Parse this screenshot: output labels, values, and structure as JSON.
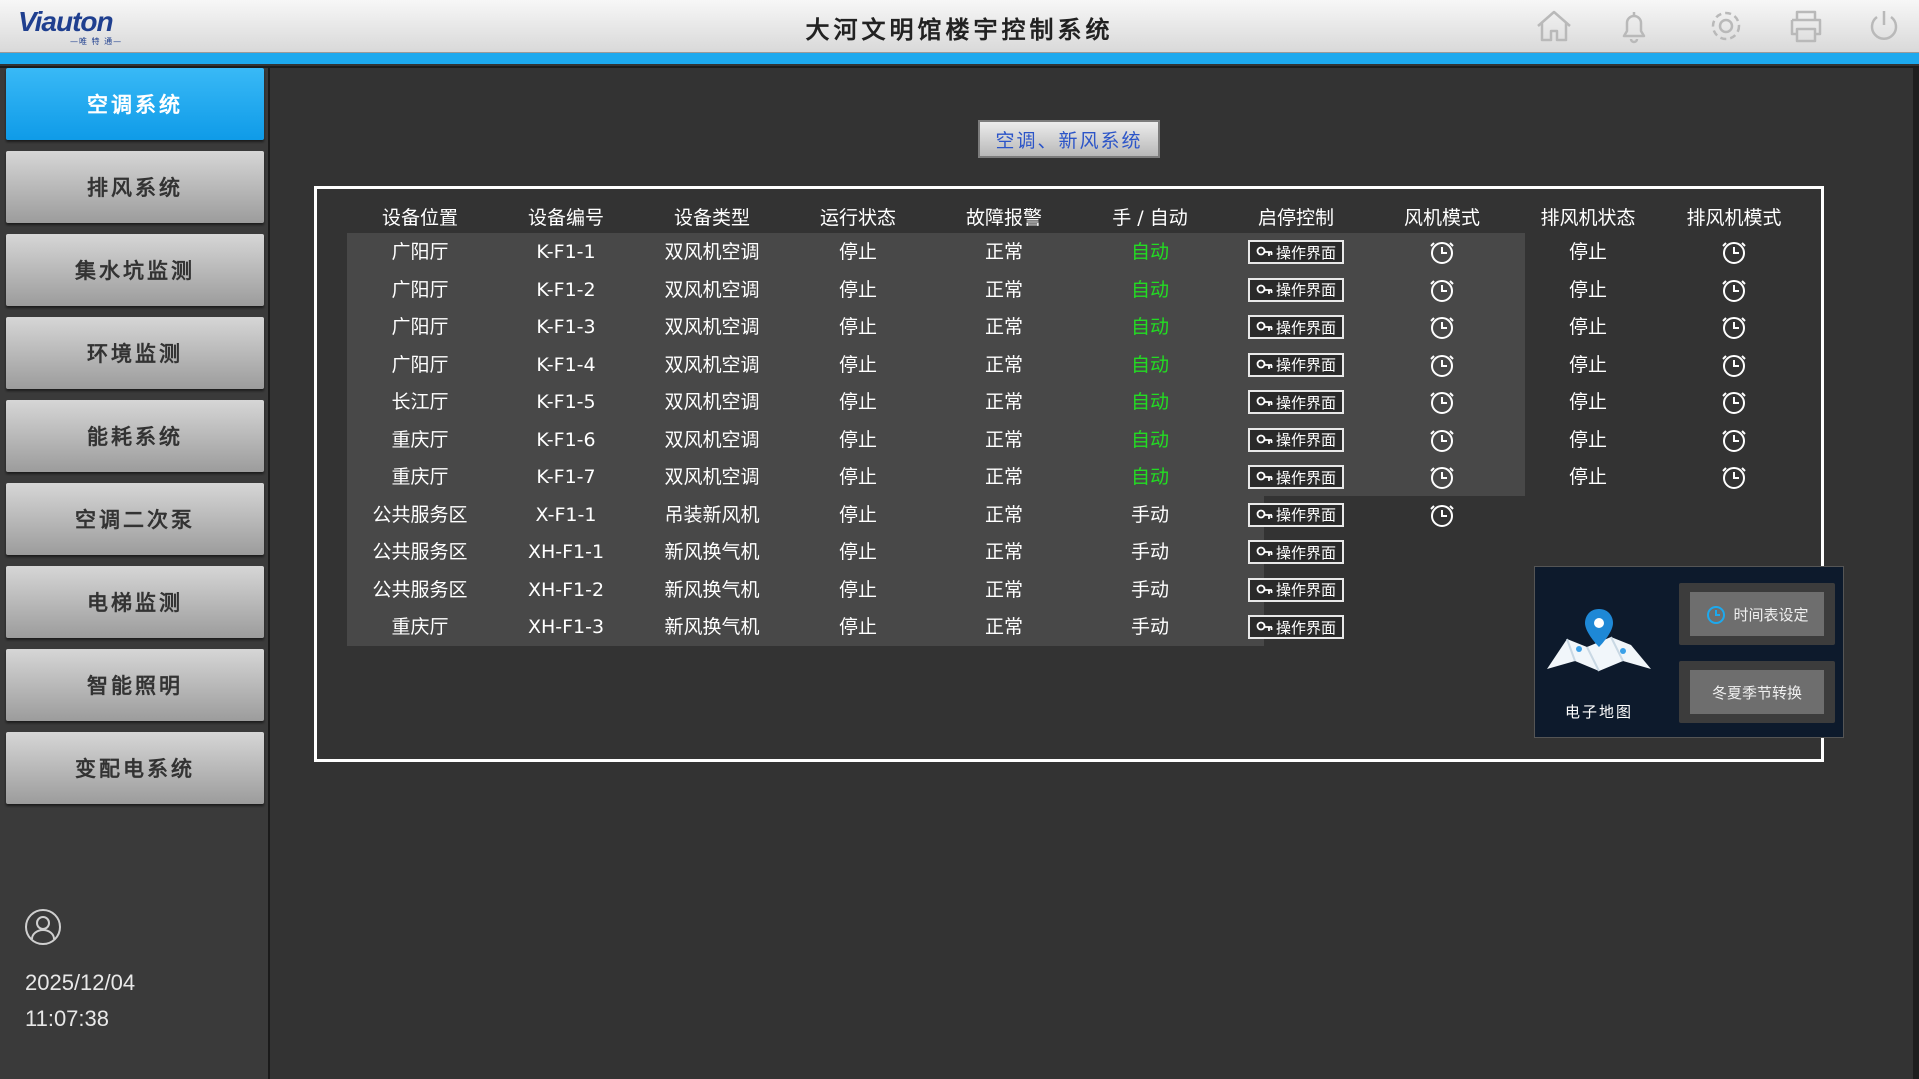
{
  "header": {
    "logo_text": "Viauton",
    "logo_tagline": "—唯 特 通—",
    "title": "大河文明馆楼宇控制系统",
    "icons": [
      "home-icon",
      "bell-icon",
      "gear-icon",
      "printer-icon",
      "power-icon"
    ]
  },
  "sidebar": {
    "items": [
      {
        "label": "空调系统",
        "active": true
      },
      {
        "label": "排风系统"
      },
      {
        "label": "集水坑监测"
      },
      {
        "label": "环境监测"
      },
      {
        "label": "能耗系统"
      },
      {
        "label": "空调二次泵"
      },
      {
        "label": "电梯监测"
      },
      {
        "label": "智能照明"
      },
      {
        "label": "变配电系统"
      }
    ],
    "date": "2025/12/04",
    "time": "11:07:38"
  },
  "main": {
    "section_title": "空调、新风系统",
    "columns": [
      "设备位置",
      "设备编号",
      "设备类型",
      "运行状态",
      "故障报警",
      "手 / 自动",
      "启停控制",
      "风机模式",
      "排风机状态",
      "排风机模式"
    ],
    "op_label": "操作界面",
    "rows": [
      {
        "location": "广阳厅",
        "id": "K-F1-1",
        "type": "双风机空调",
        "run": "停止",
        "fault": "正常",
        "mode": "自动",
        "fan_mode": "clock-icon",
        "exhaust_status": "停止",
        "exhaust_mode": "clock-icon"
      },
      {
        "location": "广阳厅",
        "id": "K-F1-2",
        "type": "双风机空调",
        "run": "停止",
        "fault": "正常",
        "mode": "自动",
        "fan_mode": "clock-icon",
        "exhaust_status": "停止",
        "exhaust_mode": "clock-icon"
      },
      {
        "location": "广阳厅",
        "id": "K-F1-3",
        "type": "双风机空调",
        "run": "停止",
        "fault": "正常",
        "mode": "自动",
        "fan_mode": "clock-icon",
        "exhaust_status": "停止",
        "exhaust_mode": "clock-icon"
      },
      {
        "location": "广阳厅",
        "id": "K-F1-4",
        "type": "双风机空调",
        "run": "停止",
        "fault": "正常",
        "mode": "自动",
        "fan_mode": "clock-icon",
        "exhaust_status": "停止",
        "exhaust_mode": "clock-icon"
      },
      {
        "location": "长江厅",
        "id": "K-F1-5",
        "type": "双风机空调",
        "run": "停止",
        "fault": "正常",
        "mode": "自动",
        "fan_mode": "clock-icon",
        "exhaust_status": "停止",
        "exhaust_mode": "clock-icon"
      },
      {
        "location": "重庆厅",
        "id": "K-F1-6",
        "type": "双风机空调",
        "run": "停止",
        "fault": "正常",
        "mode": "自动",
        "fan_mode": "clock-icon",
        "exhaust_status": "停止",
        "exhaust_mode": "clock-icon"
      },
      {
        "location": "重庆厅",
        "id": "K-F1-7",
        "type": "双风机空调",
        "run": "停止",
        "fault": "正常",
        "mode": "自动",
        "fan_mode": "clock-icon",
        "exhaust_status": "停止",
        "exhaust_mode": "clock-icon"
      },
      {
        "location": "公共服务区",
        "id": "X-F1-1",
        "type": "吊装新风机",
        "run": "停止",
        "fault": "正常",
        "mode": "手动",
        "fan_mode": "clock-icon"
      },
      {
        "location": "公共服务区",
        "id": "XH-F1-1",
        "type": "新风换气机",
        "run": "停止",
        "fault": "正常",
        "mode": "手动"
      },
      {
        "location": "公共服务区",
        "id": "XH-F1-2",
        "type": "新风换气机",
        "run": "停止",
        "fault": "正常",
        "mode": "手动"
      },
      {
        "location": "重庆厅",
        "id": "XH-F1-3",
        "type": "新风换气机",
        "run": "停止",
        "fault": "正常",
        "mode": "手动"
      }
    ],
    "tools": {
      "map_label": "电子地图",
      "schedule_label": "时间表设定",
      "season_label": "冬夏季节转换"
    }
  },
  "colors": {
    "accent_blue": "#1da9ee",
    "auto_green": "#22dd22",
    "background": "#333333"
  }
}
